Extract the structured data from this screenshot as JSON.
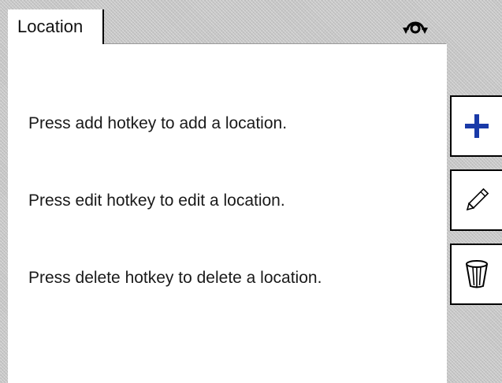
{
  "tab": {
    "label": "Location"
  },
  "status": {
    "icon": "rotate-arrows-icon"
  },
  "messages": {
    "add": "Press add hotkey to add a location.",
    "edit": "Press edit hotkey to edit a location.",
    "delete": "Press delete hotkey to delete a location."
  },
  "hotkeys": [
    {
      "name": "add",
      "icon": "plus-icon",
      "color": "#1a3aa8"
    },
    {
      "name": "edit",
      "icon": "pencil-icon"
    },
    {
      "name": "delete",
      "icon": "trash-bin-icon"
    }
  ],
  "colors": {
    "accent": "#1a3aa8",
    "background": "#c6c6c6",
    "panel": "#ffffff"
  }
}
